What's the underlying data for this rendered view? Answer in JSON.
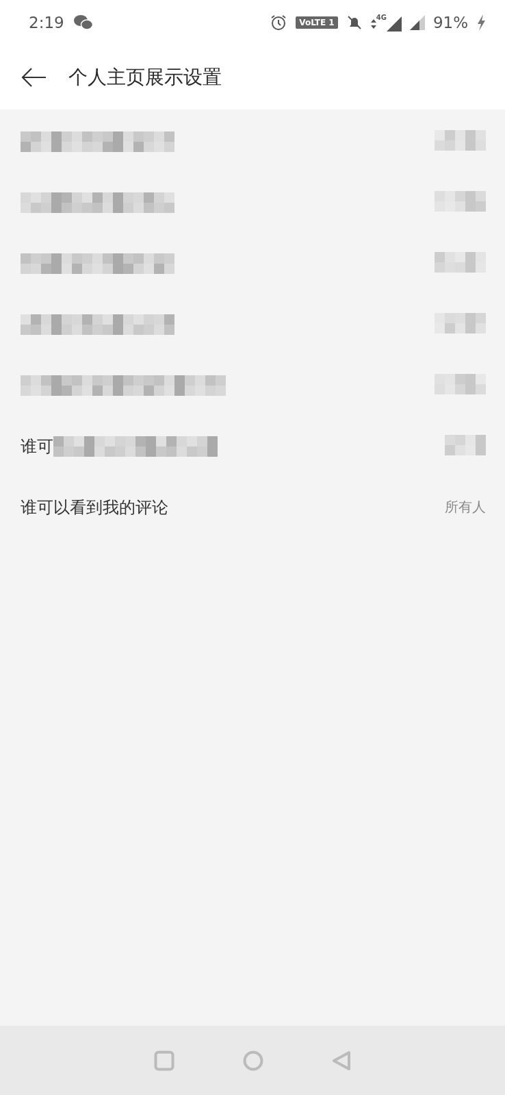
{
  "status_bar": {
    "time": "2:19",
    "volte": "VoLTE 1",
    "network": "4G",
    "battery": "91%"
  },
  "header": {
    "title": "个人主页展示设置"
  },
  "rows": [
    {
      "kind": "pixelated"
    },
    {
      "kind": "pixelated"
    },
    {
      "kind": "pixelated"
    },
    {
      "kind": "pixelated"
    },
    {
      "kind": "pixelated_long"
    },
    {
      "kind": "partial",
      "label": "谁可"
    },
    {
      "kind": "text",
      "label": "谁可以看到我的评论",
      "value": "所有人"
    }
  ]
}
